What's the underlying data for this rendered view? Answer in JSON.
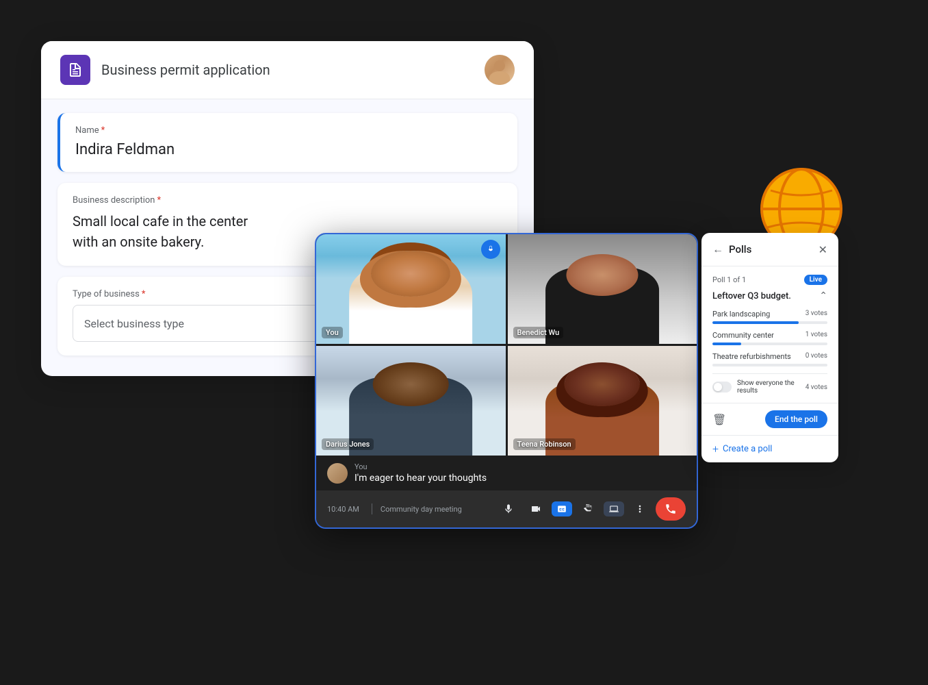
{
  "form": {
    "title": "Business permit application",
    "name_label": "Name",
    "name_required": "*",
    "name_value": "Indira Feldman",
    "description_label": "Business description",
    "description_required": "*",
    "description_value": "Small local cafe in the center\nwith an onsite bakery.",
    "type_label": "Type of business",
    "type_required": "*",
    "type_placeholder": "Select business type"
  },
  "video": {
    "tiles": [
      {
        "label": "You",
        "type": "you"
      },
      {
        "label": "Benedict Wu",
        "type": "benedict"
      },
      {
        "label": "Darius Jones",
        "type": "darius"
      },
      {
        "label": "Teena Robinson",
        "type": "teena"
      }
    ],
    "chat_sender": "You",
    "chat_message": "I'm eager to hear your thoughts",
    "time": "10:40 AM",
    "meeting_name": "Community day meeting"
  },
  "polls": {
    "title": "Polls",
    "poll_count": "Poll 1 of 1",
    "live_badge": "Live",
    "question": "Leftover Q3 budget.",
    "options": [
      {
        "label": "Park landscaping",
        "votes": "3 votes",
        "percent": 75
      },
      {
        "label": "Community center",
        "votes": "1 votes",
        "percent": 25
      },
      {
        "label": "Theatre refurbishments",
        "votes": "0 votes",
        "percent": 0
      }
    ],
    "show_results_label": "Show everyone the results",
    "show_results_votes": "4 votes",
    "end_poll_label": "End the poll",
    "create_poll_label": "Create a poll"
  },
  "toolbar": {
    "icons": [
      "info",
      "participants",
      "chat",
      "layout"
    ]
  }
}
